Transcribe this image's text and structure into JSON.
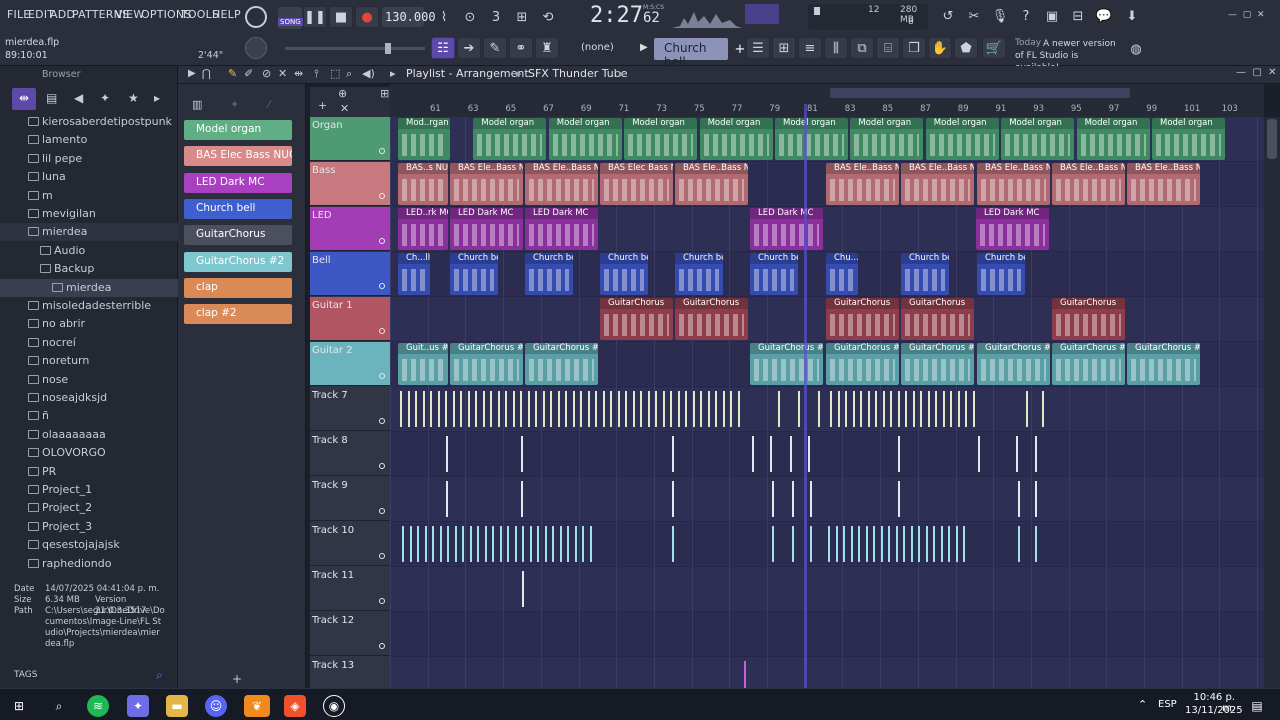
{
  "menu": [
    "FILE",
    "EDIT",
    "ADD",
    "PATTERNS",
    "VIEW",
    "OPTIONS",
    "TOOLS",
    "HELP"
  ],
  "project": {
    "file": "mierdea.flp",
    "position": "89:10:01",
    "length": "2'44\""
  },
  "transport": {
    "mode": "SONG",
    "tempo": "130.000",
    "time": "2:27",
    "time_sub": "62",
    "time_unit": "M:S:CS"
  },
  "cpu": {
    "value": "12",
    "memory": "280 MB",
    "voices": "8"
  },
  "toolbar2": {
    "pattern_select": "(none)",
    "channel": "Church bell"
  },
  "news": {
    "today": "Today",
    "message": "A newer version of FL Studio is available!"
  },
  "browser": {
    "title": "Browser",
    "items": [
      {
        "label": "kierosaberdetipostpunk",
        "level": 0
      },
      {
        "label": "lamento",
        "level": 0
      },
      {
        "label": "lil pepe",
        "level": 0
      },
      {
        "label": "luna",
        "level": 0
      },
      {
        "label": "m",
        "level": 0
      },
      {
        "label": "mevigilan",
        "level": 0
      },
      {
        "label": "mierdea",
        "level": 0,
        "open": true
      },
      {
        "label": "Audio",
        "level": 1
      },
      {
        "label": "Backup",
        "level": 1
      },
      {
        "label": "mierdea",
        "level": 2,
        "selected": true
      },
      {
        "label": "misoledadesterrible",
        "level": 0
      },
      {
        "label": "no abrir",
        "level": 0
      },
      {
        "label": "nocreí",
        "level": 0
      },
      {
        "label": "noreturn",
        "level": 0
      },
      {
        "label": "nose",
        "level": 0
      },
      {
        "label": "noseajdksjd",
        "level": 0
      },
      {
        "label": "ñ",
        "level": 0
      },
      {
        "label": "olaaaaaaaa",
        "level": 0
      },
      {
        "label": "OLOVORGO",
        "level": 0
      },
      {
        "label": "PR",
        "level": 0
      },
      {
        "label": "Project_1",
        "level": 0
      },
      {
        "label": "Project_2",
        "level": 0
      },
      {
        "label": "Project_3",
        "level": 0
      },
      {
        "label": "qesestojajajsk",
        "level": 0
      },
      {
        "label": "raphediondo",
        "level": 0
      }
    ],
    "info": {
      "date_label": "Date",
      "date": "14/07/2025 04:41:04 p. m.",
      "size_label": "Size",
      "size": "6.34 MB",
      "version": "Version 21.0.3.3517",
      "path_label": "Path",
      "path": "C:\\Users\\segur\\OneDrive\\Documentos\\Image-Line\\FL Studio\\Projects\\mierdea\\mierdea.flp"
    },
    "tags": "TAGS"
  },
  "picker": [
    {
      "label": "Model organ",
      "color": "#5fae84"
    },
    {
      "label": "BAS Elec Bass NUC",
      "color": "#d98a8a"
    },
    {
      "label": "LED Dark MC",
      "color": "#a93fc1"
    },
    {
      "label": "Church bell",
      "color": "#3f5fcf"
    },
    {
      "label": "GuitarChorus",
      "color": "#4b4f5e"
    },
    {
      "label": "GuitarChorus #2",
      "color": "#7ec7cf"
    },
    {
      "label": "clap",
      "color": "#d98a57"
    },
    {
      "label": "clap #2",
      "color": "#d98a57"
    }
  ],
  "playlist": {
    "title": "Playlist - Arrangement",
    "pattern": "SFX Thunder Tube"
  },
  "ruler": [
    "61",
    "63",
    "65",
    "67",
    "69",
    "71",
    "73",
    "75",
    "77",
    "79",
    "81",
    "83",
    "85",
    "87",
    "89",
    "91",
    "93",
    "95",
    "97",
    "99",
    "101",
    "103"
  ],
  "tracks": [
    {
      "name": "Organ",
      "color": "#4e9a72"
    },
    {
      "name": "Bass",
      "color": "#c8787f"
    },
    {
      "name": "LED",
      "color": "#a23db5"
    },
    {
      "name": "Bell",
      "color": "#3d57c4"
    },
    {
      "name": "Guitar 1",
      "color": "#b25563"
    },
    {
      "name": "Guitar 2",
      "color": "#6bb4bd"
    },
    {
      "name": "Track 7",
      "color": "#303646"
    },
    {
      "name": "Track 8",
      "color": "#303646"
    },
    {
      "name": "Track 9",
      "color": "#303646"
    },
    {
      "name": "Track 10",
      "color": "#303646"
    },
    {
      "name": "Track 11",
      "color": "#303646"
    },
    {
      "name": "Track 12",
      "color": "#303646"
    },
    {
      "name": "Track 13",
      "color": "#303646"
    }
  ],
  "clips": {
    "organ": [
      "Mod..rgan",
      "Model organ",
      "Model organ",
      "Model organ",
      "Model organ",
      "Model organ",
      "Model organ",
      "Model organ",
      "Model organ",
      "Model organ",
      "Model organ"
    ],
    "bass": [
      "BAS..s NUC",
      "BAS Ele..Bass NUC",
      "BAS Ele..Bass NUC",
      "BAS Elec Bass NUC",
      "BAS Ele..Bass NUC",
      "BAS Ele..Bass NUC",
      "BAS Ele..Bass NUC",
      "BAS Ele..Bass NUC",
      "BAS Ele..Bass NUC",
      "BAS Ele..Bass NUC"
    ],
    "led": [
      "LED..rk MC",
      "LED Dark MC",
      "LED Dark MC",
      "LED Dark MC",
      "LED Dark MC"
    ],
    "bell": [
      "Ch...ll",
      "Church bell",
      "Church bell",
      "Church bell",
      "Church bell",
      "Church bell",
      "Chu...ll",
      "Church bell",
      "Church bell"
    ],
    "guitar1": [
      "GuitarChorus",
      "GuitarChorus",
      "GuitarChorus",
      "GuitarChorus",
      "GuitarChorus"
    ],
    "guitar2": [
      "Guit..us #2",
      "GuitarChorus #2",
      "GuitarChorus #2",
      "GuitarChorus #2",
      "GuitarChorus #2",
      "GuitarChorus #2",
      "GuitarChorus #2",
      "GuitarChorus #2",
      "GuitarChorus #2"
    ]
  },
  "taskbar": {
    "lang": "ESP",
    "time": "10:46 p. m.",
    "date": "13/11/2025"
  }
}
